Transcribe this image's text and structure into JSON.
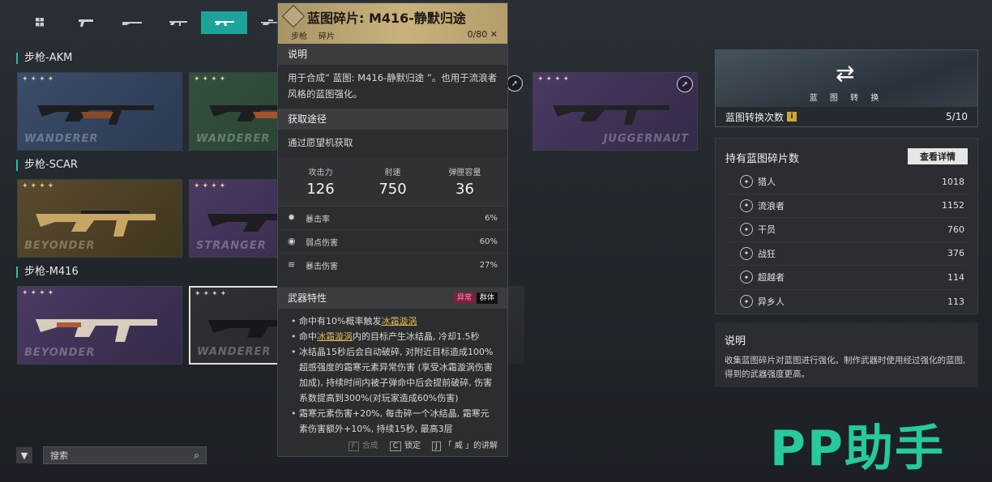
{
  "tabs": [
    {
      "icon": "grid-icon"
    },
    {
      "icon": "pistol-icon"
    },
    {
      "icon": "shotgun-icon"
    },
    {
      "icon": "smg-icon"
    },
    {
      "icon": "rifle-icon",
      "active": true
    },
    {
      "icon": "sniper-icon"
    }
  ],
  "groups": [
    {
      "title": "步枪-AKM",
      "cards": [
        {
          "stars": "✦✦✦✦",
          "brand": "WANDERER"
        },
        {
          "stars": "✦✦✦✦",
          "brand": "WANDERER"
        },
        {
          "stars": "✦✦✦✦",
          "brand": ""
        },
        {
          "stars": "✦✦✦✦",
          "brand": "JUGGERNAUT"
        }
      ]
    },
    {
      "title": "步枪-SCAR",
      "cards": [
        {
          "stars": "✦✦✦✦",
          "brand": "BEYONDER"
        },
        {
          "stars": "✦✦✦✦",
          "brand": "STRANGER"
        }
      ]
    },
    {
      "title": "步枪-M416",
      "cards": [
        {
          "stars": "✦✦✦✦",
          "brand": "BEYONDER"
        },
        {
          "stars": "✦✦✦✦",
          "brand": "WANDERER"
        }
      ]
    }
  ],
  "tooltip": {
    "title": "蓝图碎片: M416-静默归途",
    "tags": [
      "步枪",
      "碎片"
    ],
    "count": "0/80",
    "desc_header": "说明",
    "desc": "用于合成“ 蓝图: M416-静默归途 ”。也用于流浪者风格的蓝图强化。",
    "source_header": "获取途径",
    "source": "通过愿望机获取",
    "stats": [
      {
        "label": "攻击力",
        "value": "126"
      },
      {
        "label": "射速",
        "value": "750"
      },
      {
        "label": "弹匣容量",
        "value": "36"
      }
    ],
    "rows": [
      {
        "icon": "crit-rate-icon",
        "label": "暴击率",
        "value": "6%"
      },
      {
        "icon": "weakspot-icon",
        "label": "弱点伤害",
        "value": "60%"
      },
      {
        "icon": "crit-damage-icon",
        "label": "暴击伤害",
        "value": "27%"
      }
    ],
    "traits_header": "武器特性",
    "tag_abnormal": "异常",
    "tag_group": "群体",
    "b1_pre": "命中有10%概率触发",
    "b1_link": "冰霜漩涡",
    "b2_pre": "命中",
    "b2_link": "冰霜漩涡",
    "b2_post": "内的目标产生冰结晶, 冷却1.5秒",
    "b3": "冰结晶15秒后会自动破碎, 对附近目标造成100%超感强度的霜寒元素异常伤害 (享受冰霜漩涡伤害加成), 持续时间内被子弹命中后会提前破碎, 伤害系数提高到300%(对玩家造成60%伤害)",
    "b4": "霜寒元素伤害+20%, 每击碎一个冰结晶, 霜寒元素伤害额外+10%, 持续15秒, 最高3层",
    "footer": [
      {
        "key": "F",
        "label": "合成",
        "dim": true
      },
      {
        "key": "C",
        "label": "锁定",
        "dim": false
      },
      {
        "key": "J",
        "label": "「 威 」的讲解",
        "dim": false
      }
    ]
  },
  "convert": {
    "label": "蓝 图 转 换",
    "row_label": "蓝图转换次数",
    "info_icon": "i",
    "value": "5/10"
  },
  "owned": {
    "header": "持有蓝图碎片数",
    "details_button": "查看详情",
    "items": [
      {
        "name": "猎人",
        "value": "1018"
      },
      {
        "name": "流浪者",
        "value": "1152"
      },
      {
        "name": "干员",
        "value": "760"
      },
      {
        "name": "战狂",
        "value": "376"
      },
      {
        "name": "超越者",
        "value": "114"
      },
      {
        "name": "异乡人",
        "value": "113"
      }
    ]
  },
  "description": {
    "header": "说明",
    "text": "收集蓝图碎片对蓝图进行强化。制作武器时使用经过强化的蓝图, 得到的武器强度更高。"
  },
  "watermark": "PP助手",
  "search": {
    "placeholder": "搜索"
  }
}
